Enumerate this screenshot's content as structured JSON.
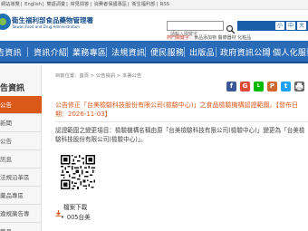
{
  "util_bar": {
    "links": [
      "網站導覽",
      "English",
      "雙語詞彙",
      "常見問答",
      "消費者保護專區",
      "衛生福利部",
      "RSS"
    ]
  },
  "header": {
    "site_name": "衛生福利部食品藥物管理署",
    "site_name_en": "Taiwan Food and Drug Administration",
    "search_placeholder": "請輸入關鍵字",
    "hot_keywords_label": "熱門關鍵字：",
    "hot_keywords": "食品添加物   醫療器材   化粧品",
    "font_sizes": [
      "小",
      "中",
      "大"
    ]
  },
  "nav": {
    "items": [
      "業務專區",
      "法規資訊",
      "便民服務",
      "出版品",
      "政府資訊公開",
      "個人化服務"
    ],
    "partial_left": "告資訊",
    "partial_mid": "資訊介紹"
  },
  "sidebar": {
    "heading": "告資訊",
    "items": [
      "公告",
      "新聞",
      "公告",
      "訊息",
      "法規沿革區",
      "藥品專區",
      "違規廣告專",
      "雙月"
    ]
  },
  "breadcrumb": {
    "home": "首頁",
    "items": [
      "公告資訊",
      "本署公告"
    ],
    "prefix": "目前位置："
  },
  "article": {
    "title": "公告修正「台美檢驗科技股份有限公司(檢驗中心)」之食品檢驗機構認證範圍。【發布日期：2026-11-03】",
    "body": "認證範圍之變更項目：檢驗機構名稱由原「台美檢驗科技有限公司(檢驗中心)」變更為「台美檢驗科技股份有限公司(檢驗中心)」。",
    "download_label": "檔案下載",
    "download_file": "005台美"
  },
  "colors": {
    "nav_blue": "#2a6bb7",
    "accent_orange": "#d9581a",
    "facebook": "#3b5998",
    "google": "#dd4b39",
    "line": "#00b900",
    "plurk": "#cf682f",
    "twitter": "#1da1f2",
    "print": "#666666"
  }
}
